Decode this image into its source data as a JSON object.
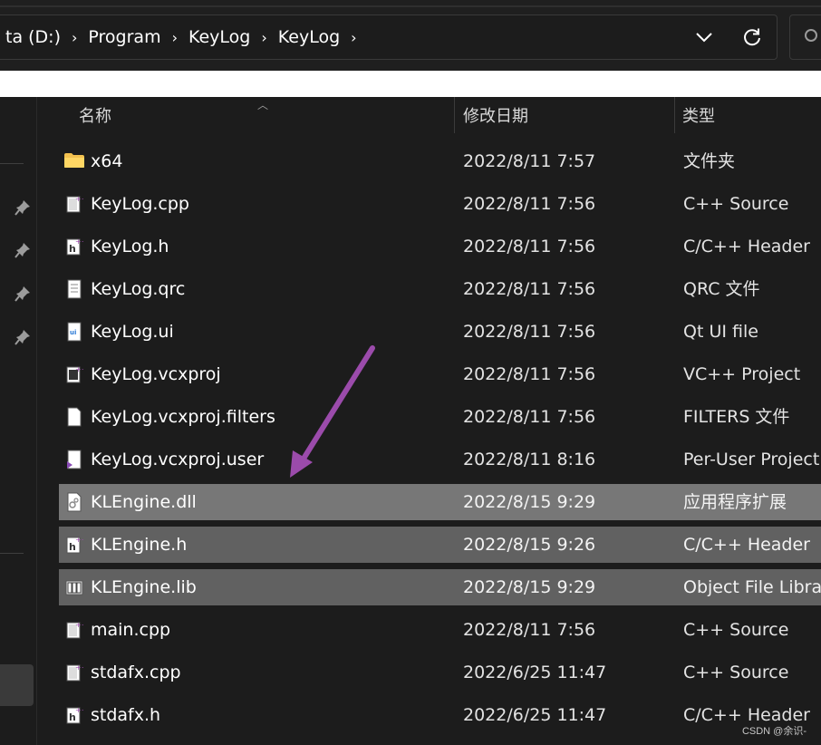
{
  "address": {
    "crumbs": [
      "ta (D:)",
      "Program",
      "KeyLog",
      "KeyLog"
    ],
    "separator": "›",
    "dropdown_icon": "chevron-down-icon",
    "refresh_icon": "refresh-icon",
    "search_icon": "search-icon"
  },
  "columns": {
    "name": "名称",
    "date": "修改日期",
    "type": "类型"
  },
  "files": [
    {
      "name": "x64",
      "date": "2022/8/11 7:57",
      "type": "文件夹",
      "icon": "folder-icon"
    },
    {
      "name": "KeyLog.cpp",
      "date": "2022/8/11 7:56",
      "type": "C++ Source",
      "icon": "cpp-file-icon"
    },
    {
      "name": "KeyLog.h",
      "date": "2022/8/11 7:56",
      "type": "C/C++ Header",
      "icon": "header-file-icon"
    },
    {
      "name": "KeyLog.qrc",
      "date": "2022/8/11 7:56",
      "type": "QRC 文件",
      "icon": "text-file-icon"
    },
    {
      "name": "KeyLog.ui",
      "date": "2022/8/11 7:56",
      "type": "Qt UI file",
      "icon": "qt-ui-file-icon"
    },
    {
      "name": "KeyLog.vcxproj",
      "date": "2022/8/11 7:56",
      "type": "VC++ Project",
      "icon": "vcxproj-file-icon"
    },
    {
      "name": "KeyLog.vcxproj.filters",
      "date": "2022/8/11 7:56",
      "type": "FILTERS 文件",
      "icon": "blank-file-icon"
    },
    {
      "name": "KeyLog.vcxproj.user",
      "date": "2022/8/11 8:16",
      "type": "Per-User Project O",
      "icon": "user-project-file-icon"
    },
    {
      "name": "KLEngine.dll",
      "date": "2022/8/15 9:29",
      "type": "应用程序扩展",
      "icon": "dll-file-icon"
    },
    {
      "name": "KLEngine.h",
      "date": "2022/8/15 9:26",
      "type": "C/C++ Header",
      "icon": "header-file-icon"
    },
    {
      "name": "KLEngine.lib",
      "date": "2022/8/15 9:29",
      "type": "Object File Library",
      "icon": "lib-file-icon"
    },
    {
      "name": "main.cpp",
      "date": "2022/8/11 7:56",
      "type": "C++ Source",
      "icon": "cpp-file-icon"
    },
    {
      "name": "stdafx.cpp",
      "date": "2022/6/25 11:47",
      "type": "C++ Source",
      "icon": "cpp-file-icon"
    },
    {
      "name": "stdafx.h",
      "date": "2022/6/25 11:47",
      "type": "C/C++ Header",
      "icon": "header-file-icon"
    }
  ],
  "selection": {
    "selected_rows": [
      "KLEngine.dll",
      "KLEngine.h",
      "KLEngine.lib"
    ]
  },
  "annotation": {
    "arrow_color": "#9b4bab"
  },
  "watermark": "CSDN @余识-"
}
